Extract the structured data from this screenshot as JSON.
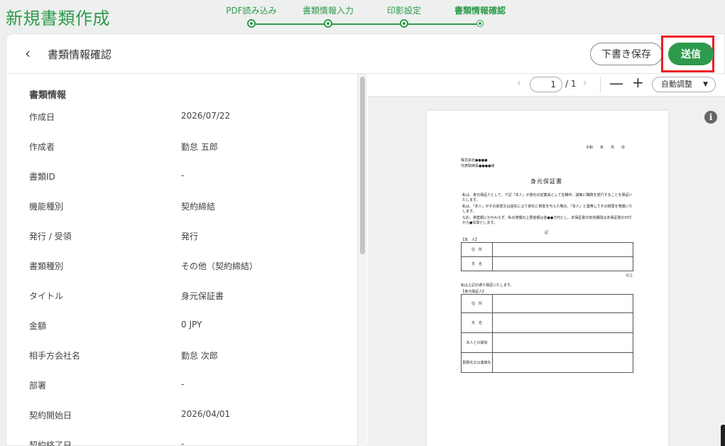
{
  "app_title": "新規書類作成",
  "steps": [
    {
      "label": "PDF読み込み"
    },
    {
      "label": "書類情報入力"
    },
    {
      "label": "印影設定"
    },
    {
      "label": "書類情報確認"
    }
  ],
  "header": {
    "title": "書類情報確認",
    "draft_label": "下書き保存",
    "send_label": "送信"
  },
  "info": {
    "section_title": "書類情報",
    "rows": [
      {
        "key": "作成日",
        "value": "2026/07/22"
      },
      {
        "key": "作成者",
        "value": "勤怠 五郎"
      },
      {
        "key": "書類ID",
        "value": "-"
      },
      {
        "key": "機能種別",
        "value": "契約締結"
      },
      {
        "key": "発行 / 受領",
        "value": "発行"
      },
      {
        "key": "書類種別",
        "value": "その他（契約締結）"
      },
      {
        "key": "タイトル",
        "value": "身元保証書"
      },
      {
        "key": "金額",
        "value": "0 JPY"
      },
      {
        "key": "相手方会社名",
        "value": "勤怠 次郎"
      },
      {
        "key": "部署",
        "value": "-"
      },
      {
        "key": "契約開始日",
        "value": "2026/04/01"
      },
      {
        "key": "契約終了日",
        "value": "-"
      }
    ]
  },
  "viewer": {
    "page": "1",
    "total": "/ 1",
    "zoom": "自動調整",
    "prev_icon": "chevron-left-icon",
    "next_icon": "chevron-right-icon",
    "zoom_out_icon": "minus-icon",
    "zoom_in_icon": "plus-icon",
    "info_icon": "info-icon"
  },
  "document": {
    "date_line": "令和　　年　　月　　日",
    "company": "株式会社●●●●",
    "representative": "代表取締役●●●●様",
    "title": "身元保証書",
    "para1": "私は、身元保証人として、下記「本人」が貴社の従業員として在職中、誠実に職務を遂行することを保証いたします。",
    "para2": "私は、「本人」がその故意又は過失により貴社に損害を与えた場合、「本人」と連帯してその損害を賠償いたします。",
    "para3": "なお、損害額にかかわらず、私の賠償の上限金額は金●●万円とし、本保証書の有効期間は本保証書の日付から●年間とします。",
    "ki": "記",
    "honnin_label": "【本　人】",
    "addr": "住　所",
    "name": "氏　名",
    "ijou": "以上",
    "guarantor_intro": "私は上記の通り保証いたします。",
    "guarantor_label": "【身元保証人】",
    "relation": "本人との関係",
    "workplace": "勤務先又は連絡先"
  },
  "colors": {
    "brand_green": "#2e9a4c",
    "highlight_red": "#ee1c24"
  }
}
